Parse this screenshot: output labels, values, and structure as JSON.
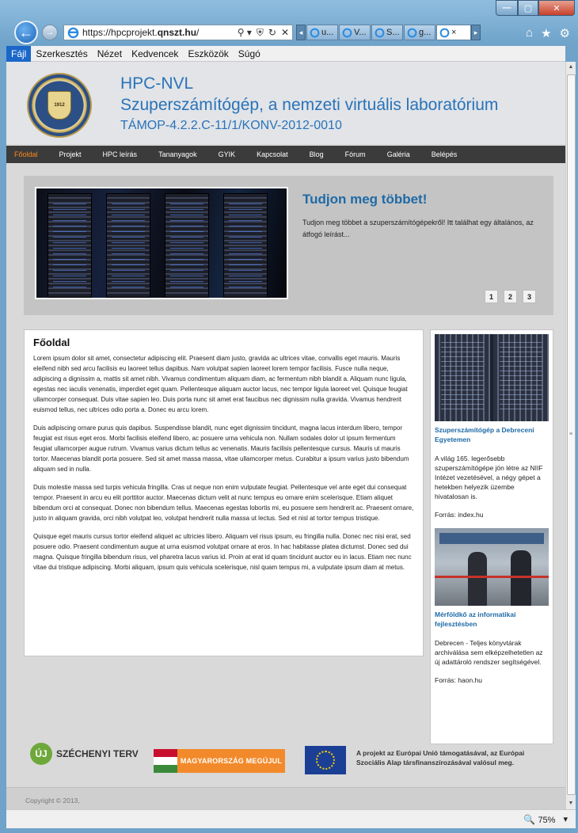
{
  "browser": {
    "url_prefix": "https://hpcprojekt.",
    "url_host": "qnszt.hu",
    "url_suffix": "/",
    "address_tools": [
      "⚲ ▾",
      "⛨",
      "↻",
      "✕"
    ],
    "tabs": [
      {
        "label": "u..."
      },
      {
        "label": "V..."
      },
      {
        "label": "S..."
      },
      {
        "label": "g..."
      },
      {
        "label": "×",
        "active": true
      }
    ],
    "zoom": "75%",
    "colors": {
      "accent": "#1a67c9",
      "close": "#c7402a"
    }
  },
  "menubar": {
    "items": [
      "Fájl",
      "Szerkesztés",
      "Nézet",
      "Kedvencek",
      "Eszközök",
      "Súgó"
    ]
  },
  "header": {
    "title1": "HPC-NVL",
    "title2": "Szuperszámítógép, a nemzeti virtuális laboratórium",
    "title3": "TÁMOP-4.2.2.C-11/1/KONV-2012-0010",
    "logo_year": "1912",
    "colors": {
      "title": "#2a73b8"
    }
  },
  "nav": {
    "items": [
      "Főoldal",
      "Projekt",
      "HPC leírás",
      "Tananyagok",
      "GYIK",
      "Kapcsolat",
      "Blog",
      "Fórum",
      "Galéria",
      "Belépés"
    ],
    "active_index": 0,
    "colors": {
      "active": "#ff8a1c",
      "background": "#3b3b3b"
    }
  },
  "slider": {
    "title": "Tudjon meg többet!",
    "text": "Tudjon meg többet a szuperszámítógépekről! Itt találhat egy általános, az átfogó leírást...",
    "pages": [
      "1",
      "2",
      "3"
    ]
  },
  "main": {
    "heading": "Főoldal",
    "paragraphs": [
      "Lorem ipsum dolor sit amet, consectetur adipiscing elit. Praesent diam justo, gravida ac ultrices vitae, convallis eget mauris. Mauris eleifend nibh sed arcu facilisis eu laoreet tellus dapibus. Nam volutpat sapien laoreet lorem tempor facilisis. Fusce nulla neque, adipiscing a dignissim a, mattis sit amet nibh. Vivamus condimentum aliquam diam, ac fermentum nibh blandit a. Aliquam nunc ligula, egestas nec iaculis venenatis, imperdiet eget quam. Pellentesque aliquam auctor lacus, nec tempor ligula laoreet vel. Quisque feugiat ullamcorper consequat. Duis vitae sapien leo. Duis porta nunc sit amet erat faucibus nec dignissim nulla gravida. Vivamus hendrerit euismod tellus, nec ultrices odio porta a. Donec eu arcu lorem.",
      "Duis adipiscing ornare purus quis dapibus. Suspendisse blandit, nunc eget dignissim tincidunt, magna lacus interdum libero, tempor feugiat est risus eget eros. Morbi facilisis eleifend libero, ac posuere urna vehicula non. Nullam sodales dolor ut ipsum fermentum feugiat ullamcorper augue rutrum. Vivamus varius dictum tellus ac venenatis. Mauris facilisis pellentesque cursus. Mauris ut mauris tortor. Maecenas blandit porta posuere. Sed sit amet massa massa, vitae ullamcorper metus. Curabitur a ipsum varius justo bibendum aliquam sed in nulla.",
      "Duis molestie massa sed turpis vehicula fringilla. Cras ut neque non enim vulputate feugiat. Pellentesque vel ante eget dui consequat tempor. Praesent in arcu eu elit porttitor auctor. Maecenas dictum velit at nunc tempus eu ornare enim scelerisque. Etiam aliquet bibendum orci at consequat. Donec non bibendum tellus. Maecenas egestas lobortis mi, eu posuere sem hendrerit ac. Praesent ornare, justo in aliquam gravida, orci nibh volutpat leo, volutpat hendrerit nulla massa ut lectus. Sed et nisl at tortor tempus tristique.",
      "Quisque eget mauris cursus tortor eleifend aliquet ac ultricies libero. Aliquam vel risus ipsum, eu fringilla nulla. Donec nec nisi erat, sed posuere odio. Praesent condimentum augue at urna euismod volutpat ornare at eros. In hac habitasse platea dictumst. Donec sed dui magna. Quisque fringilla bibendum risus, vel pharetra lacus varius id. Proin at erat id quam tincidunt auctor eu in lacus. Etiam nec nunc vitae dui tristique adipiscing. Morbi aliquam, ipsum quis vehicula scelerisque, nisl quam tempus mi, a vulputate ipsum diam at metus."
    ]
  },
  "sidebar": {
    "items": [
      {
        "link": "Szuperszámítógép a Debreceni Egyetemen",
        "text": "A világ 165. legerősebb szuperszámítógépe jön létre az NIIF Intézet vezetésével, a négy gépet a hetekben helyezik üzembe hivatalosan is.",
        "source": "Forrás: index.hu"
      },
      {
        "link": "Mérföldkő az informatikai fejlesztésben",
        "text": "Debrecen - Teljes könyvtárak archiválása sem elképzelhetetlen az új adattároló rendszer segítségével.",
        "source": "Forrás: haon.hu"
      }
    ]
  },
  "footer": {
    "szechenyi_badge": "ÚJ",
    "szechenyi": "SZÉCHENYI TERV",
    "magyarorszag": "MAGYARORSZÁG MEGÚJUL",
    "eu_text": "A projekt az Európai Unió támogatásával, az Európai Szociális Alap társfinanszírozásával valósul meg.",
    "copyright": "Copyright © 2013,"
  }
}
